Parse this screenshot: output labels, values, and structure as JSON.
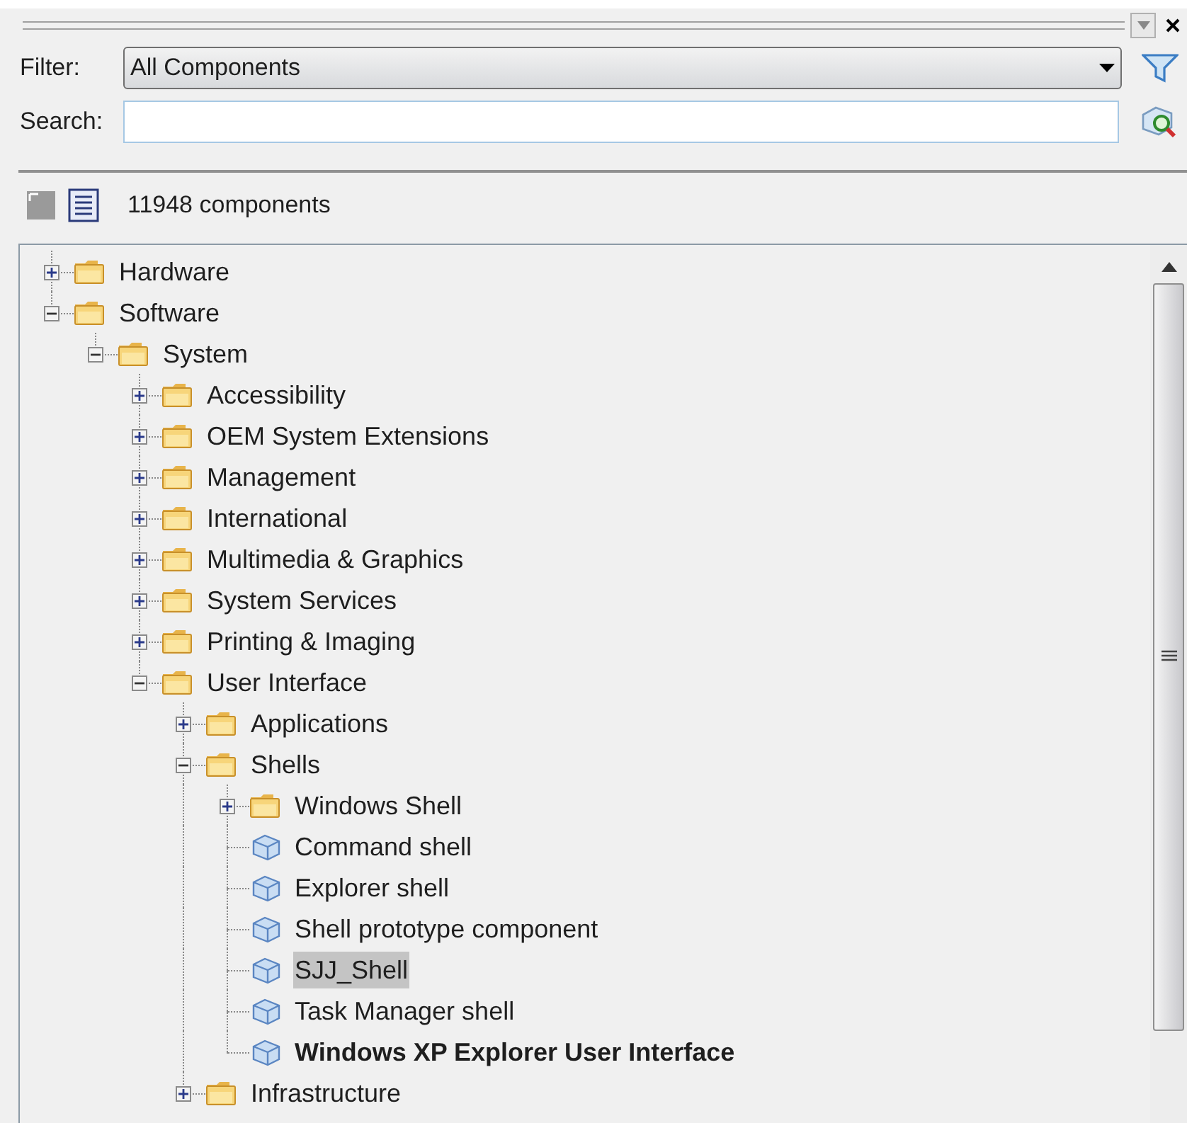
{
  "filter": {
    "label": "Filter:",
    "value": "All Components"
  },
  "search": {
    "label": "Search:"
  },
  "toolbar": {
    "count": "11948 components"
  },
  "tree": [
    {
      "label": "Hardware",
      "kind": "folder",
      "expanded": false,
      "selected": false
    },
    {
      "label": "Software",
      "kind": "folder",
      "expanded": true,
      "selected": false,
      "children": [
        {
          "label": "System",
          "kind": "folder",
          "expanded": true,
          "selected": false,
          "children": [
            {
              "label": "Accessibility",
              "kind": "folder",
              "expanded": false,
              "selected": false
            },
            {
              "label": "OEM System Extensions",
              "kind": "folder",
              "expanded": false,
              "selected": false
            },
            {
              "label": "Management",
              "kind": "folder",
              "expanded": false,
              "selected": false
            },
            {
              "label": "International",
              "kind": "folder",
              "expanded": false,
              "selected": false
            },
            {
              "label": "Multimedia & Graphics",
              "kind": "folder",
              "expanded": false,
              "selected": false
            },
            {
              "label": "System Services",
              "kind": "folder",
              "expanded": false,
              "selected": false
            },
            {
              "label": "Printing & Imaging",
              "kind": "folder",
              "expanded": false,
              "selected": false
            },
            {
              "label": "User Interface",
              "kind": "folder",
              "expanded": true,
              "selected": false,
              "children": [
                {
                  "label": "Applications",
                  "kind": "folder",
                  "expanded": false,
                  "selected": false
                },
                {
                  "label": "Shells",
                  "kind": "folder",
                  "expanded": true,
                  "selected": false,
                  "children": [
                    {
                      "label": "Windows Shell",
                      "kind": "folder",
                      "expanded": false,
                      "selected": false
                    },
                    {
                      "label": "Command shell",
                      "kind": "component",
                      "bold": false,
                      "selected": false
                    },
                    {
                      "label": "Explorer shell",
                      "kind": "component",
                      "bold": false,
                      "selected": false
                    },
                    {
                      "label": "Shell prototype component",
                      "kind": "component",
                      "bold": false,
                      "selected": false
                    },
                    {
                      "label": "SJJ_Shell",
                      "kind": "component",
                      "bold": false,
                      "selected": true
                    },
                    {
                      "label": "Task Manager shell",
                      "kind": "component",
                      "bold": false,
                      "selected": false
                    },
                    {
                      "label": "Windows XP Explorer User Interface",
                      "kind": "component",
                      "bold": true,
                      "selected": false
                    }
                  ]
                },
                {
                  "label": "Infrastructure",
                  "kind": "folder",
                  "expanded": false,
                  "selected": false
                }
              ]
            }
          ]
        }
      ]
    }
  ]
}
